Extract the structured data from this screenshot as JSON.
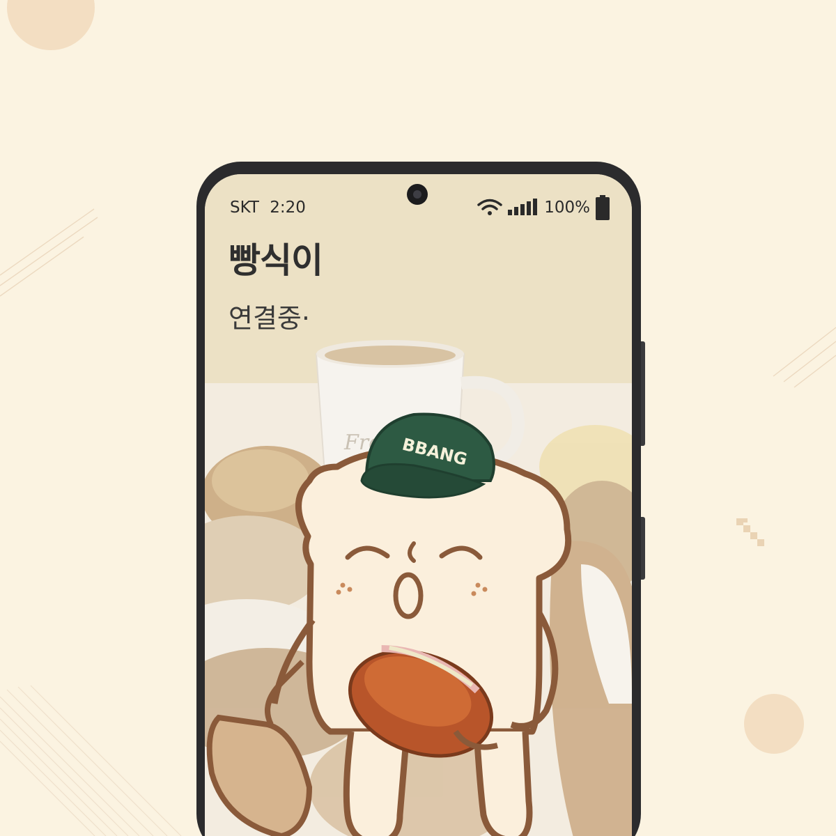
{
  "status_bar": {
    "carrier": "SKT",
    "time": "2:20",
    "battery": "100%",
    "icons": [
      "wifi-icon",
      "signal-icon",
      "battery-icon"
    ]
  },
  "screen": {
    "title": "빵식이",
    "subtitle": "연결중·"
  },
  "illustration": {
    "cap_text": "BBANG",
    "mug_text": "Fre"
  },
  "colors": {
    "background": "#fbf3e1",
    "phone_frame": "#2b2b2d",
    "cap_green": "#2d5a43",
    "outline_brown": "#8a5a3a",
    "bread_cream": "#fbefdc"
  }
}
